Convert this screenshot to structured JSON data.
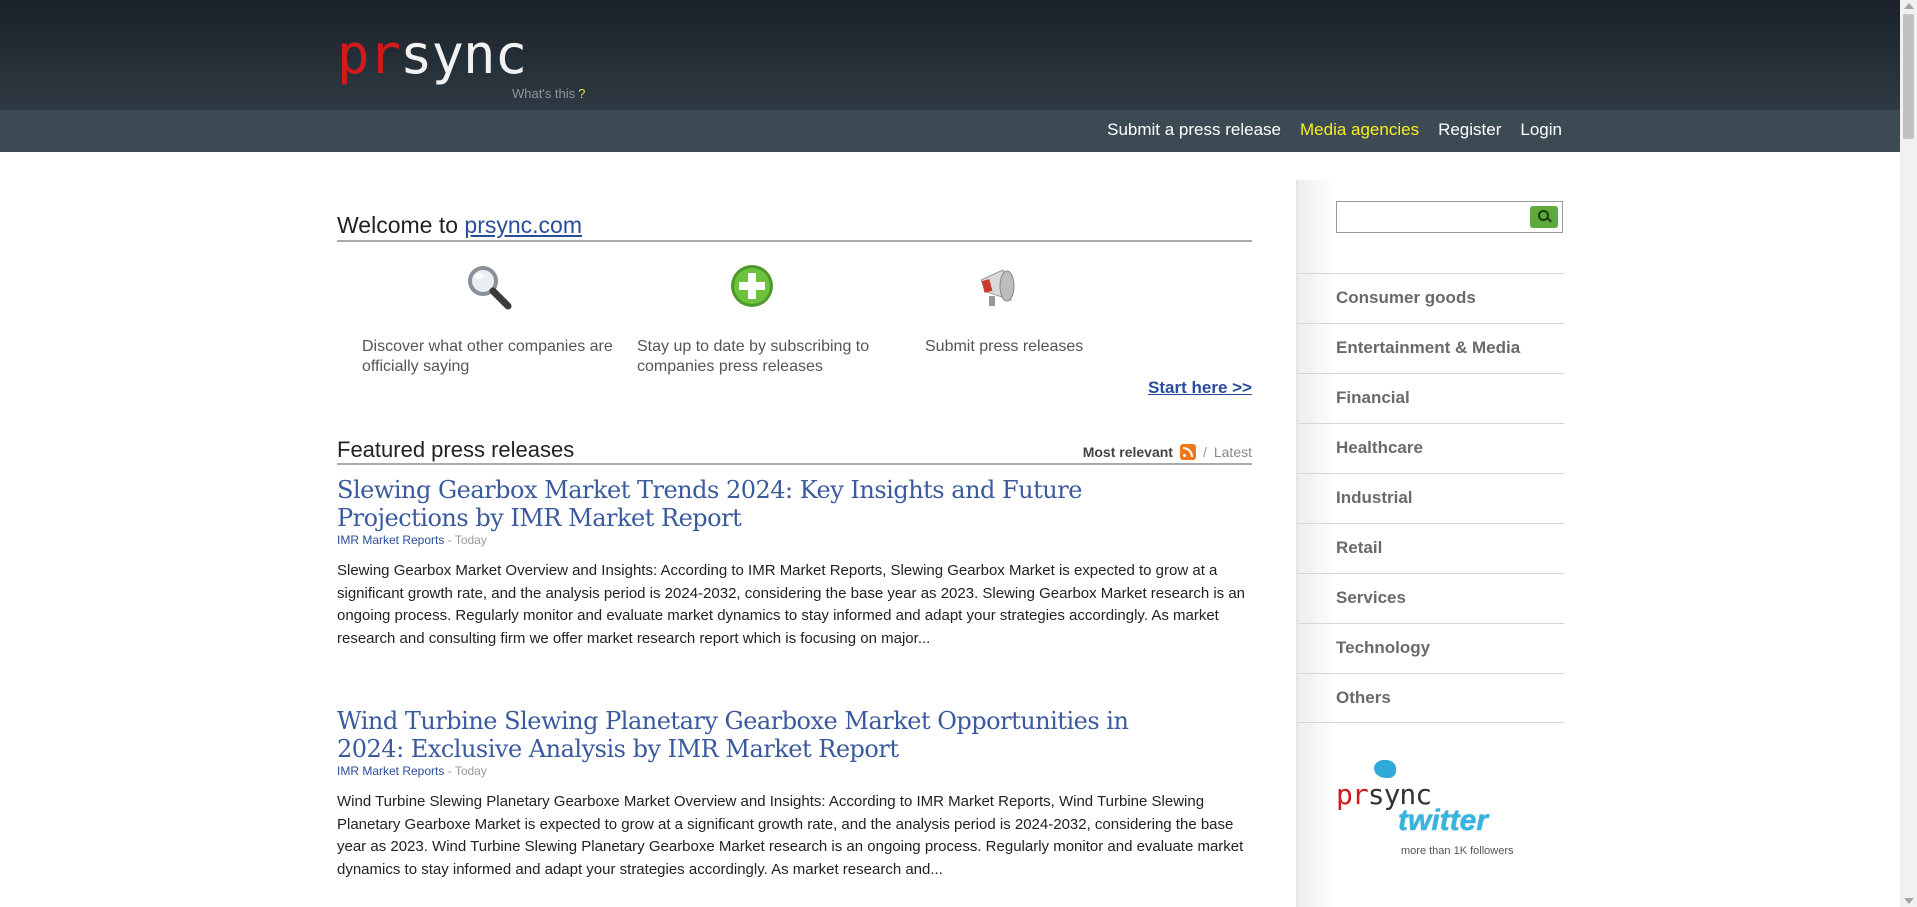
{
  "header": {
    "logo_pr": "pr",
    "logo_sync": "sync",
    "whats_this": "What's this",
    "whats_this_q": "?",
    "nav": [
      "Submit a press release",
      "Media agencies",
      "Register",
      "Login"
    ]
  },
  "welcome": {
    "prefix": "Welcome to ",
    "link": "prsync.com"
  },
  "features": [
    {
      "icon": "magnifier-icon",
      "text": "Discover what other companies are officially saying"
    },
    {
      "icon": "plus-icon",
      "text": "Stay up to date by subscribing to companies press releases"
    },
    {
      "icon": "megaphone-icon",
      "text": "Submit press releases"
    }
  ],
  "start_here": "Start here >>",
  "featured": {
    "title": "Featured press releases",
    "most_relevant": "Most relevant",
    "separator": "/",
    "latest": "Latest"
  },
  "press_releases": [
    {
      "title": "Slewing Gearbox Market Trends 2024: Key Insights and Future Projections by IMR Market Report",
      "source": "IMR Market Reports",
      "date": "- Today",
      "body": "Slewing Gearbox Market Overview and Insights: According to IMR Market Reports, Slewing Gearbox Market is expected to grow at a significant growth rate, and the analysis period is 2024-2032, considering the base year as 2023. Slewing Gearbox Market research is an ongoing process. Regularly monitor and evaluate market dynamics to stay informed and adapt your strategies accordingly. As market research and consulting firm we offer market research report which is focusing on major..."
    },
    {
      "title": "Wind Turbine Slewing Planetary Gearboxe Market Opportunities in 2024: Exclusive Analysis by IMR Market Report",
      "source": "IMR Market Reports",
      "date": "- Today",
      "body": "Wind Turbine Slewing Planetary Gearboxe Market Overview and Insights: According to IMR Market Reports, Wind Turbine Slewing Planetary Gearboxe Market is expected to grow at a significant growth rate, and the analysis period is 2024-2032, considering the base year as 2023. Wind Turbine Slewing Planetary Gearboxe Market research is an ongoing process. Regularly monitor and evaluate market dynamics to stay informed and adapt your strategies accordingly. As market research and..."
    }
  ],
  "sidebar": {
    "search_value": "",
    "categories": [
      "Consumer goods",
      "Entertainment & Media",
      "Financial",
      "Healthcare",
      "Industrial",
      "Retail",
      "Services",
      "Technology",
      "Others"
    ],
    "twitter": {
      "logo_pr": "pr",
      "logo_sync": "sync",
      "word": "twitter",
      "followers": "more than 1K followers"
    }
  },
  "colors": {
    "header_dark": "#1a2128",
    "nav_bar": "#3c4a53",
    "logo_red": "#d31a1a",
    "nav_highlight": "#f7f01e",
    "link_blue": "#2a4d9a",
    "title_blue": "#3a5a9e",
    "search_green": "#5fa93d"
  }
}
